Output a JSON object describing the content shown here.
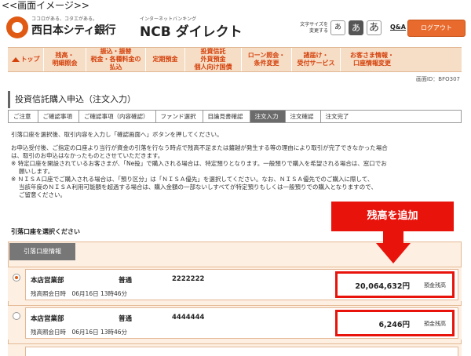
{
  "caption": "<<画面イメージ>>",
  "header": {
    "logo_tagline": "ココロがある、コタエがある。",
    "bank_name": "西日本シティ銀行",
    "direct_sub": "インターネットバンキング",
    "direct_name": "NCB ダイレクト",
    "font_size_label": "文字サイズを\n変更する",
    "font_sizes": [
      "あ",
      "あ",
      "あ"
    ],
    "qa_label": "Q&A",
    "logout_label": "ログアウト"
  },
  "nav": {
    "items": [
      "トップ",
      "残高・\n明細照会",
      "振込・振替\n税金・各種料金の\n払込",
      "定期預金",
      "投資信託\n外貨預金\n個人向け国債",
      "ローン照会・\n条件変更",
      "諸届け・\n受付サービス",
      "お客さま情報・\n口座情報変更"
    ]
  },
  "screen_id": "画面ID：BFO307",
  "page_title": "投資信託購入申込（注文入力）",
  "steps": [
    "ご注意",
    "ご確認事項",
    "ご確認事項（内容確認）",
    "ファンド選択",
    "目論見書確認",
    "注文入力",
    "注文確認",
    "注文完了"
  ],
  "active_step": 5,
  "instruction": "引落口座を選択後、取引内容を入力し「確認画面へ」ボタンを押してください。",
  "notes": [
    "お申込受付後、ご指定の口座より当行が資金の引落を行なう時点で残高不足または鍍越が発生する等の理由により取引が完了できなかった場合",
    "は、取引のお申込はなかったものとさせていただきます。",
    "※ 特定口座を開設されているお客さまが、「Ne投」で購入される場合は、特定預りとなります。一般預りで購入を希望される場合は、窓口でお",
    "願いします。",
    "※ ＮＩＳＡ口座でご購入される場合は、「預り区分」は「ＮＩＳＡ優先」を選択してください。なお、ＮＩＳＡ優先でのご購入に際して、",
    "当該年度のＮＩＳＡ利用可能額を超過する場合は、購入金額の一部ないしすべてが特定預りもしくは一般預りでの購入となりますので、",
    "ご留意ください。"
  ],
  "section_label": "引落口座を選択ください",
  "account_tab": "引落口座情報",
  "callout": "残高を追加",
  "accounts": [
    {
      "branch": "本店営業部",
      "type": "普通",
      "number": "2222222",
      "date_label": "残高照会日時　06月16日 13時46分",
      "balance": "20,064,632円",
      "balance_label": "預金残高",
      "selected": true
    },
    {
      "branch": "本店営業部",
      "type": "普通",
      "number": "4444444",
      "date_label": "残高照会日時　06月16日 13時46分",
      "balance": "6,246円",
      "balance_label": "預金残高",
      "selected": false
    }
  ]
}
